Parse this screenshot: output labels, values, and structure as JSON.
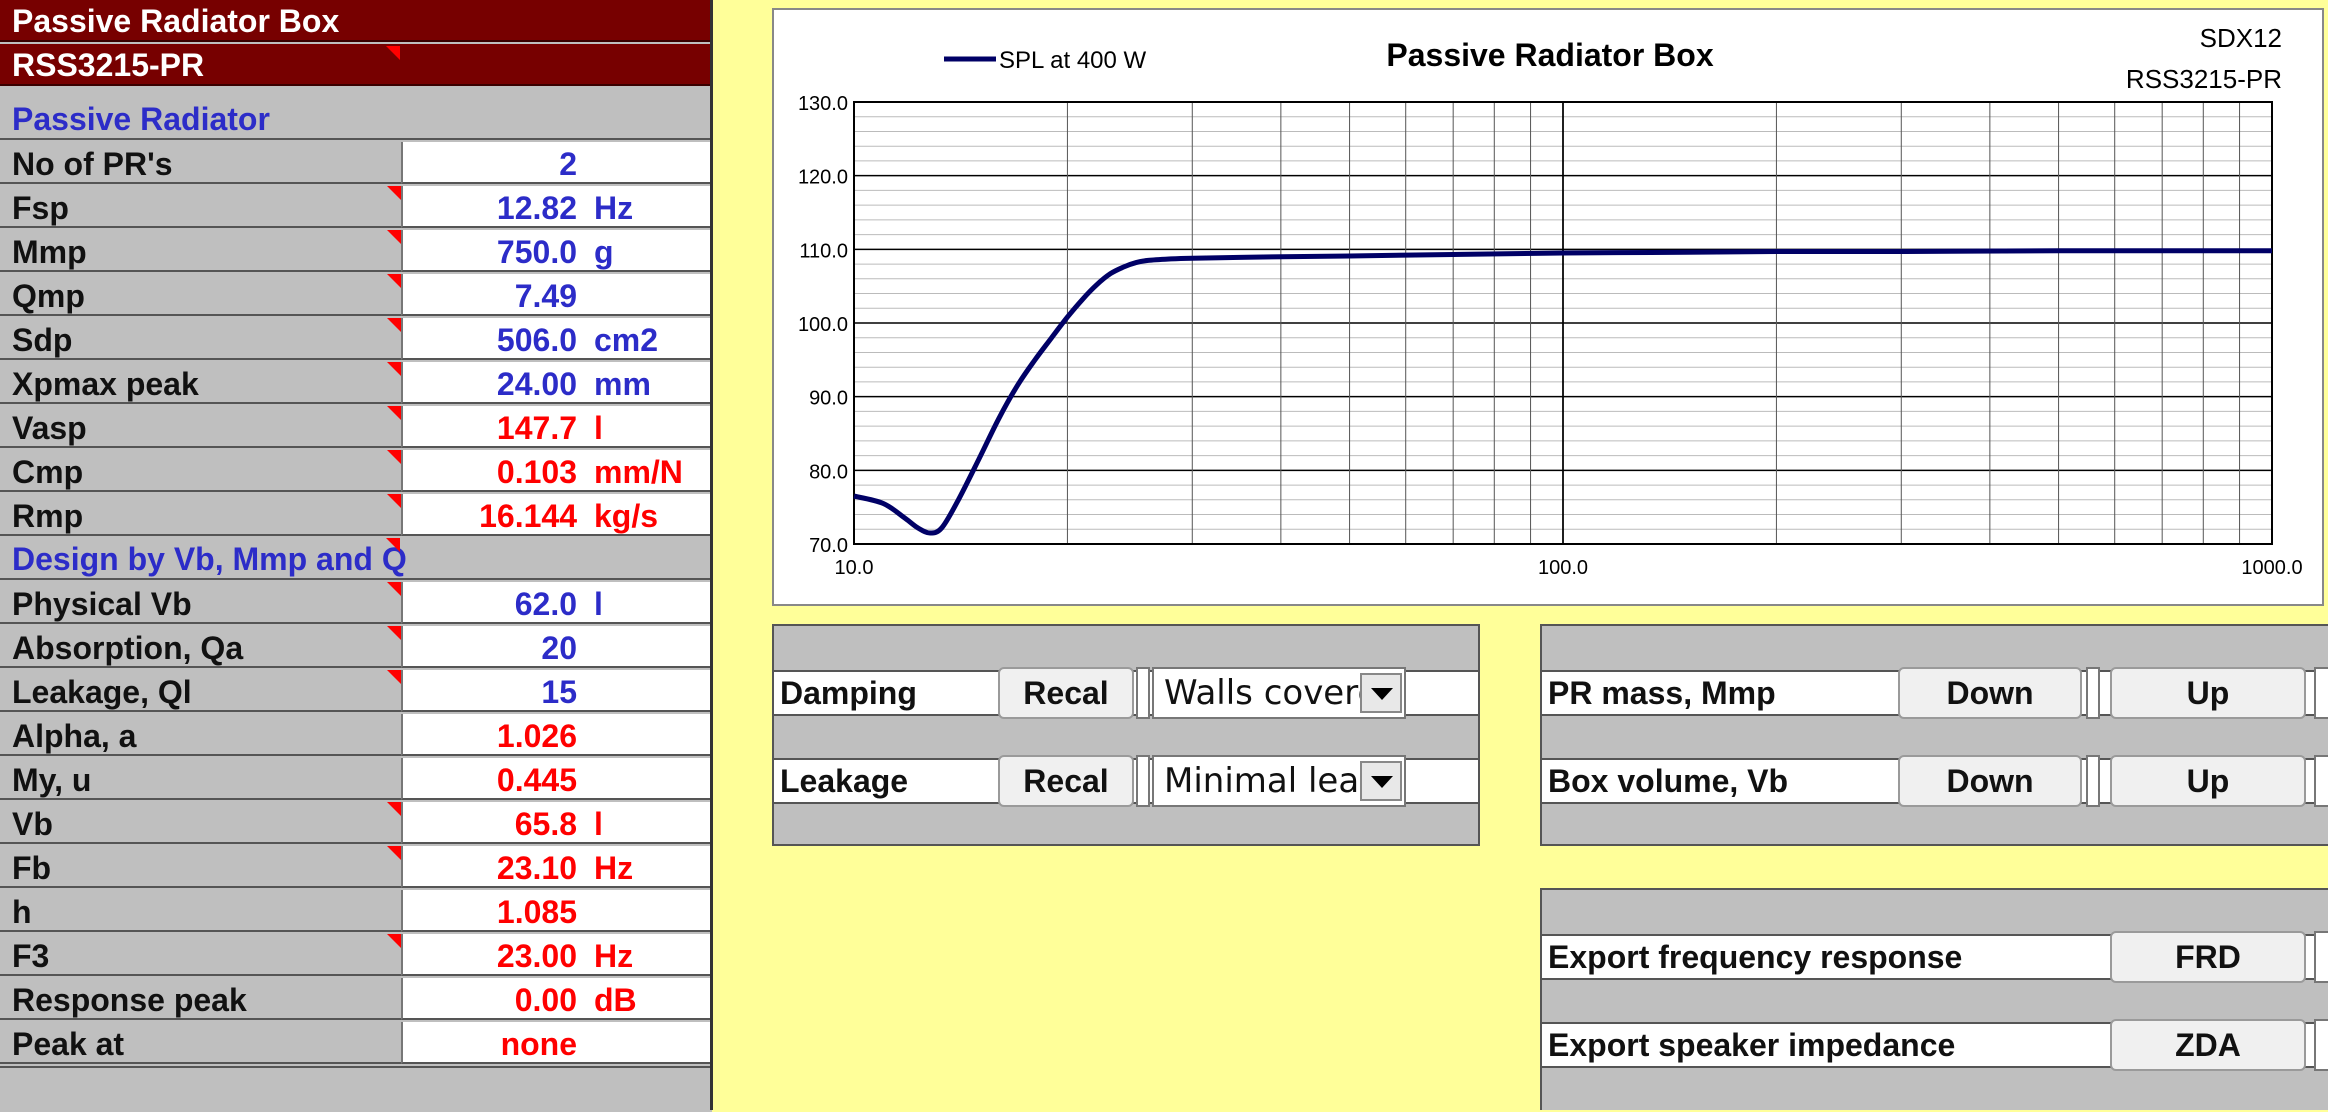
{
  "sheet": {
    "title": "Passive Radiator Box",
    "model": "RSS3215-PR",
    "section_pr": "Passive Radiator",
    "section_design": "Design by Vb, Mmp and Q",
    "rows_pr": [
      {
        "label": "No of PR's",
        "value": "2",
        "unit": "",
        "color": "blue",
        "flag": false
      },
      {
        "label": "Fsp",
        "value": "12.82",
        "unit": "Hz",
        "color": "blue",
        "flag": true
      },
      {
        "label": "Mmp",
        "value": "750.0",
        "unit": "g",
        "color": "blue",
        "flag": true
      },
      {
        "label": "Qmp",
        "value": "7.49",
        "unit": "",
        "color": "blue",
        "flag": true
      },
      {
        "label": "Sdp",
        "value": "506.0",
        "unit": "cm2",
        "color": "blue",
        "flag": true
      },
      {
        "label": "Xpmax peak",
        "value": "24.00",
        "unit": "mm",
        "color": "blue",
        "flag": true
      },
      {
        "label": "Vasp",
        "value": "147.7",
        "unit": "l",
        "color": "red",
        "flag": true
      },
      {
        "label": "Cmp",
        "value": "0.103",
        "unit": "mm/N",
        "color": "red",
        "flag": true
      },
      {
        "label": "Rmp",
        "value": "16.144",
        "unit": "kg/s",
        "color": "red",
        "flag": true
      }
    ],
    "rows_design": [
      {
        "label": "Physical Vb",
        "value": "62.0",
        "unit": "l",
        "color": "blue",
        "flag": true
      },
      {
        "label": "Absorption, Qa",
        "value": "20",
        "unit": "",
        "color": "blue",
        "flag": true
      },
      {
        "label": "Leakage, Ql",
        "value": "15",
        "unit": "",
        "color": "blue",
        "flag": true
      },
      {
        "label": "Alpha, a",
        "value": "1.026",
        "unit": "",
        "color": "red",
        "flag": false
      },
      {
        "label": "My, u",
        "value": "0.445",
        "unit": "",
        "color": "red",
        "flag": false
      },
      {
        "label": "Vb",
        "value": "65.8",
        "unit": "l",
        "color": "red",
        "flag": true
      },
      {
        "label": "Fb",
        "value": "23.10",
        "unit": "Hz",
        "color": "red",
        "flag": true
      },
      {
        "label": "h",
        "value": "1.085",
        "unit": "",
        "color": "red",
        "flag": false
      },
      {
        "label": "F3",
        "value": "23.00",
        "unit": "Hz",
        "color": "red",
        "flag": true
      },
      {
        "label": "Response peak",
        "value": "0.00",
        "unit": "dB",
        "color": "red",
        "flag": false
      },
      {
        "label": "Peak at",
        "value": "none",
        "unit": "",
        "color": "red",
        "flag": false
      }
    ]
  },
  "controls": {
    "damping_label": "Damping",
    "damping_button": "Recal",
    "damping_value": "Walls covered",
    "leakage_label": "Leakage",
    "leakage_button": "Recal",
    "leakage_value": "Minimal leakage",
    "pr_mass_label": "PR mass, Mmp",
    "box_volume_label": "Box volume, Vb",
    "down_label": "Down",
    "up_label": "Up",
    "export_fr_label": "Export frequency response",
    "export_fr_button": "FRD",
    "export_imp_label": "Export speaker impedance",
    "export_imp_button": "ZDA"
  },
  "colors": {
    "header_bg": "#770000",
    "background": "#ffff99",
    "blue_text": "#2c2cc8",
    "red_text": "#ff0000",
    "curve": "#000066"
  },
  "chart_data": {
    "type": "line",
    "title": "Passive Radiator Box",
    "corner_text": [
      "SDX12",
      "RSS3215-PR"
    ],
    "xlabel": "",
    "ylabel": "",
    "xscale": "log",
    "xlim": [
      10,
      1000
    ],
    "ylim": [
      70,
      130
    ],
    "x_ticks": [
      "10.0",
      "100.0",
      "1000.0"
    ],
    "y_ticks": [
      "70.0",
      "80.0",
      "90.0",
      "100.0",
      "110.0",
      "120.0",
      "130.0"
    ],
    "grid": true,
    "legend_position": "top-left",
    "series": [
      {
        "name": "SPL at 400 W",
        "x": [
          10,
          11,
          11.8,
          12.3,
          12.8,
          13.3,
          14,
          15,
          16,
          17,
          18,
          19,
          20,
          21,
          22,
          23,
          24,
          25,
          26,
          28,
          30,
          35,
          40,
          50,
          70,
          100,
          150,
          200,
          300,
          500,
          700,
          1000
        ],
        "y": [
          76.5,
          75.5,
          73.5,
          72.2,
          71.5,
          72.2,
          75.8,
          81.5,
          87.0,
          91.5,
          95.0,
          98.0,
          100.8,
          103.2,
          105.2,
          106.7,
          107.6,
          108.2,
          108.5,
          108.7,
          108.8,
          108.9,
          109.0,
          109.1,
          109.3,
          109.5,
          109.6,
          109.7,
          109.7,
          109.8,
          109.8,
          109.8
        ]
      }
    ]
  }
}
